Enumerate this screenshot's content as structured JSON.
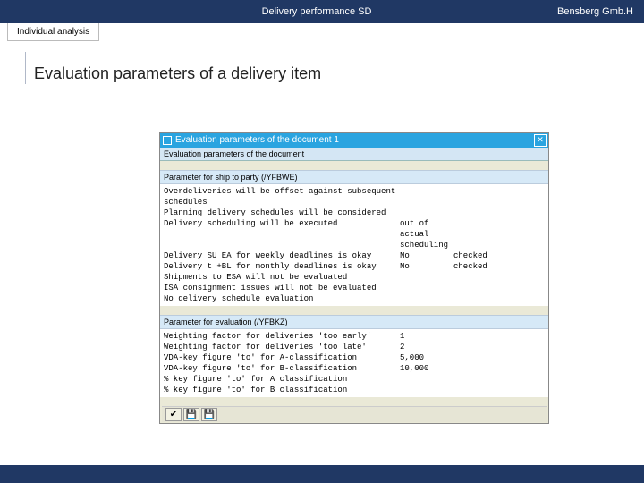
{
  "header": {
    "title": "Delivery performance SD",
    "company": "Bensberg Gmb.H"
  },
  "tab": "Individual analysis",
  "page_title": "Evaluation parameters of a delivery item",
  "sap": {
    "window_title": "Evaluation parameters of the document 1",
    "sub_title": "Evaluation parameters of the document",
    "section1_header": "Parameter for ship to party (/YFBWE)",
    "section1_rows": [
      {
        "label": "Overdeliveries will be offset against subsequent schedules",
        "v1": "",
        "v2": ""
      },
      {
        "label": "Planning delivery schedules will be considered",
        "v1": "",
        "v2": ""
      },
      {
        "label": "Delivery scheduling will be executed",
        "v1": "out of actual scheduling",
        "v2": ""
      },
      {
        "label": "Delivery SU EA for weekly deadlines is okay",
        "v1": "No",
        "v2": "checked"
      },
      {
        "label": "Delivery t +BL  for monthly deadlines is okay",
        "v1": "No",
        "v2": "checked"
      },
      {
        "label": "Shipments to ESA will not be evaluated",
        "v1": "",
        "v2": ""
      },
      {
        "label": "ISA consignment issues will not be evaluated",
        "v2": "",
        "v1": ""
      },
      {
        "label": "No delivery schedule evaluation",
        "v1": "",
        "v2": ""
      }
    ],
    "section2_header": "Parameter for evaluation (/YFBKZ)",
    "section2_rows": [
      {
        "label": "Weighting factor for deliveries 'too early'",
        "v1": "1",
        "v2": ""
      },
      {
        "label": "Weighting factor for deliveries 'too late'",
        "v1": "2",
        "v2": ""
      },
      {
        "label": "VDA-key figure 'to' for A-classification",
        "v1": "5,000",
        "v2": ""
      },
      {
        "label": "VDA-key figure 'to' for B-classification",
        "v1": "10,000",
        "v2": ""
      },
      {
        "label": "%   key figure 'to' for A classification",
        "v1": "",
        "v2": ""
      },
      {
        "label": "%   key figure 'to' for B classification",
        "v1": "",
        "v2": ""
      }
    ]
  },
  "icons": {
    "check": "✔",
    "save": "💾",
    "close": "✕"
  }
}
